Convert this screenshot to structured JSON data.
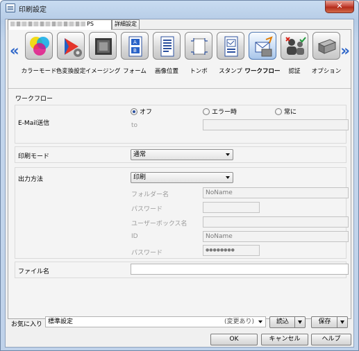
{
  "window": {
    "title": "印刷設定",
    "close_label": "✕"
  },
  "tabs": [
    {
      "label": "PS"
    },
    {
      "label": "詳細設定"
    }
  ],
  "categories": [
    {
      "label": "カラーモード",
      "icon": "color-mode-icon"
    },
    {
      "label": "色変換設定",
      "icon": "color-conversion-icon"
    },
    {
      "label": "イメージング",
      "icon": "imaging-icon"
    },
    {
      "label": "フォーム",
      "icon": "form-icon"
    },
    {
      "label": "画像位置",
      "icon": "image-position-icon"
    },
    {
      "label": "トンボ",
      "icon": "crop-marks-icon"
    },
    {
      "label": "スタンプ",
      "icon": "stamp-icon"
    },
    {
      "label": "ワークフロー",
      "icon": "workflow-icon",
      "selected": true
    },
    {
      "label": "認証",
      "icon": "authentication-icon"
    },
    {
      "label": "オプション",
      "icon": "option-icon"
    }
  ],
  "nav": {
    "prev": "«",
    "next": "»"
  },
  "workflow": {
    "section_title": "ワークフロー",
    "email": {
      "label": "E-Mail送信",
      "options": [
        "オフ",
        "エラー時",
        "常に"
      ],
      "selected": "オフ",
      "to_label": "to",
      "to_value": ""
    },
    "print_mode": {
      "label": "印刷モード",
      "value": "通常"
    },
    "output": {
      "label": "出力方法",
      "value": "印刷",
      "folder_label": "フォルダー名",
      "folder_value": "NoName",
      "password_label": "パスワード",
      "password_value": "",
      "userbox_label": "ユーザーボックス名",
      "userbox_value": "",
      "id_label": "ID",
      "id_value": "NoName",
      "password2_label": "パスワード",
      "password2_value": "●●●●●●●●"
    },
    "filename": {
      "label": "ファイル名",
      "value": ""
    }
  },
  "favorites": {
    "label": "お気に入り",
    "value": "標準設定",
    "status": "(変更あり)",
    "load_label": "読込",
    "save_label": "保存"
  },
  "buttons": {
    "ok": "OK",
    "cancel": "キャンセル",
    "help": "ヘルプ"
  }
}
